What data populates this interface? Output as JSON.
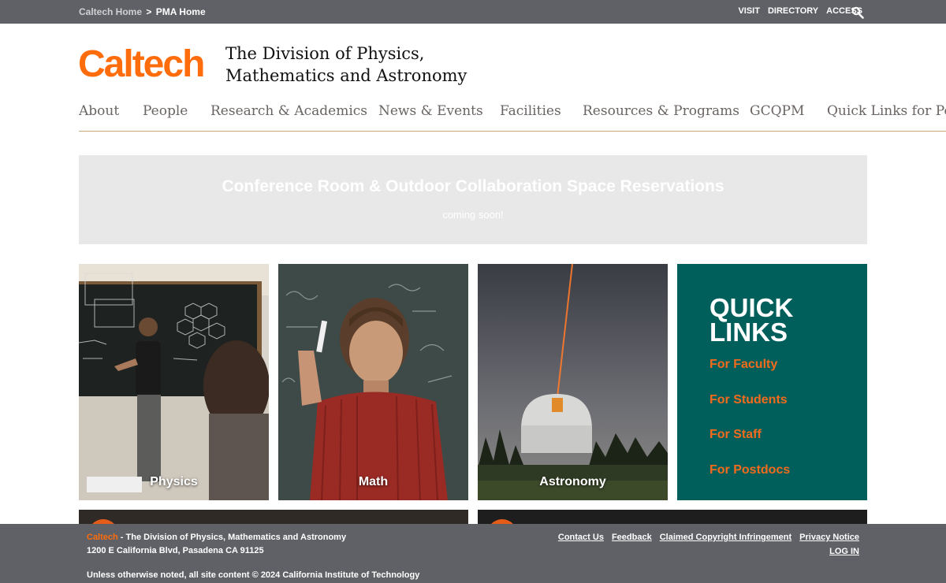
{
  "topbar": {
    "breadcrumb": [
      "Caltech Home",
      ">",
      "PMA Home"
    ],
    "utility_links": [
      "VISIT",
      "DIRECTORY",
      "ACCESS"
    ]
  },
  "header": {
    "logo": "Caltech",
    "division_line1": "The Division of Physics,",
    "division_line2": "Mathematics and Astronomy"
  },
  "nav": {
    "items": [
      "About",
      "People",
      "Research & Academics",
      "News & Events",
      "Facilities",
      "Resources & Programs",
      "GCQPM",
      "Quick Links for Postdocs"
    ]
  },
  "banner": {
    "title": "Conference Room & Outdoor Collaboration Space Reservations",
    "subtitle": "coming soon!"
  },
  "tiles": [
    {
      "label": "Physics"
    },
    {
      "label": "Math"
    },
    {
      "label": "Astronomy"
    }
  ],
  "quick_links": {
    "title_line1": "QUICK",
    "title_line2": "LINKS",
    "links": [
      "For Faculty",
      "For Students",
      "For Staff",
      "For Postdocs"
    ]
  },
  "footer": {
    "brand": "Caltech",
    "brand_rest": " - The Division of Physics, Mathematics and Astronomy",
    "address": "1200 E California Blvd, Pasadena CA 91125",
    "copyright": "Unless otherwise noted, all site content © 2024 California Institute of Technology",
    "links": [
      "Contact Us",
      "Feedback",
      "Claimed Copyright Infringement",
      "Privacy Notice"
    ],
    "login": "LOG IN"
  },
  "colors": {
    "brand_orange": "#ff6c0c",
    "topbar_gray": "#5f6166",
    "quick_links_teal": "#005f5b",
    "link_orange": "#f26b1d"
  }
}
